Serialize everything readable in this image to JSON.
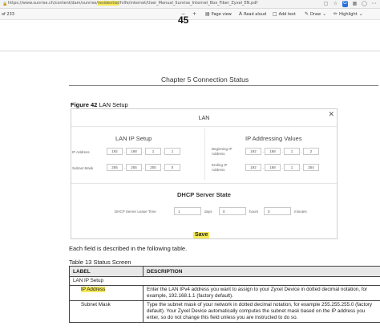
{
  "browser": {
    "url": "https://www.sunrise.ch/content/dam/sunrise/residential/hilfe/internet/User_Manual_Sunrise_Internet_Box_Fiber_Zyxel_EN.pdf",
    "url_prefix": "https://www.sunrise.ch/content/dam/sunrise/",
    "url_highlight": "residential",
    "url_suffix": "/hilfe/internet/User_Manual_Sunrise_Internet_Box_Fiber_Zyxel_EN.pdf"
  },
  "pdf_toolbar": {
    "page_count": "of 233",
    "page_view_label": "Page view",
    "read_aloud_label": "Read aloud",
    "add_text_label": "Add text",
    "draw_label": "Draw",
    "highlight_label": "Highlight"
  },
  "document": {
    "page_number": "45",
    "chapter_header": "Chapter 5 Connection Status",
    "figure_caption_bold": "Figure 42",
    "figure_caption_text": "LAN Setup",
    "intro_sentence": "Each field is described in the following table.",
    "table_caption": "Table 13 Status Screen"
  },
  "lan_dialog": {
    "title": "LAN",
    "lan_ip_setup": {
      "heading": "LAN IP Setup",
      "ip_address_label": "IP Address",
      "ip_address": [
        "192",
        "168",
        "1",
        "1"
      ],
      "subnet_mask_label": "Subnet Mask",
      "subnet_mask": [
        "255",
        "255",
        "255",
        "0"
      ]
    },
    "ip_addressing_values": {
      "heading": "IP Addressing Values",
      "beginning_label": "Beginning IP Address",
      "beginning_ip": [
        "192",
        "168",
        "1",
        "2"
      ],
      "ending_label": "Ending IP Address",
      "ending_ip": [
        "192",
        "168",
        "1",
        "254"
      ]
    },
    "dhcp": {
      "heading": "DHCP Server State",
      "lease_label": "DHCP Server Lease Time",
      "days_value": "1",
      "days_label": "days",
      "hours_value": "0",
      "hours_label": "hours",
      "minutes_value": "0",
      "minutes_label": "minutes"
    },
    "save_label": "Save"
  },
  "table": {
    "headers": [
      "LABEL",
      "DESCRIPTION"
    ],
    "rows": [
      {
        "label": "LAN IP Setup",
        "description": ""
      },
      {
        "label": "IP Address",
        "description": "Enter the LAN IPv4 address you want to assign to your Zyxel Device in dotted decimal notation, for example, 192.168.1.1 (factory default)."
      },
      {
        "label": "Subnet Mask",
        "description": "Type the subnet mask of your network in dotted decimal notation, for example 255.255.255.0 (factory default). Your Zyxel Device automatically computes the subnet mask based on the IP address you enter, so do not change this field unless you are instructed to do so."
      }
    ]
  },
  "colors": {
    "highlight": "#f6e95a",
    "table_header_bg": "#e8e8e8"
  }
}
